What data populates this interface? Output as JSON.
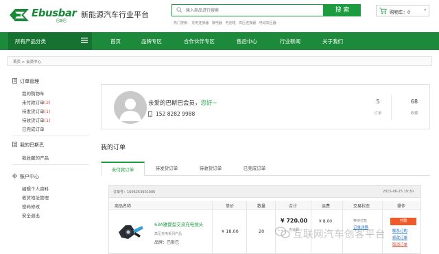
{
  "colors": {
    "brand_green": "#1d9b3f",
    "nav_green": "#1d8a3b",
    "accent_red": "#e0452b",
    "pay_orange": "#f05a28"
  },
  "header": {
    "logo_text": "Ebusbar",
    "logo_sub": "巴斯巴",
    "slogan": "新能源汽车行业平台",
    "search_placeholder": "输入商品进行搜索",
    "search_button": "搜 索",
    "hot_label": "热门搜索:",
    "hot_terms": [
      "充电连接器",
      "接电器",
      "电池箱",
      "高压连接器",
      "电动高压器"
    ],
    "cart_label": "购物车：0",
    "cart_caret": "▾"
  },
  "nav": {
    "all_label": "所有产品分类",
    "items": [
      "首页",
      "品牌专区",
      "合作伙伴专区",
      "售后中心",
      "行业新闻",
      "关于我们"
    ]
  },
  "breadcrumb": "首页 > 会员中心",
  "sidebar": {
    "groups": [
      {
        "title": "订单管理",
        "icon": "document-icon",
        "links": [
          {
            "label": "我的购物车",
            "count": ""
          },
          {
            "label": "未付款订单",
            "count": "(2)"
          },
          {
            "label": "待发货订单",
            "count": "(1)"
          },
          {
            "label": "待收货订单",
            "count": "(1)"
          },
          {
            "label": "已完成订单",
            "count": ""
          }
        ]
      },
      {
        "title": "我的巴斯巴",
        "icon": "document-icon",
        "links": [
          {
            "label": "我收藏的产品",
            "count": ""
          }
        ]
      },
      {
        "title": "账户中心",
        "icon": "gear-icon",
        "links": [
          {
            "label": "编辑个人资料",
            "count": ""
          },
          {
            "label": "收货地址管理",
            "count": ""
          },
          {
            "label": "密码修改",
            "count": ""
          },
          {
            "label": "安全退出",
            "count": ""
          }
        ]
      }
    ]
  },
  "user": {
    "greeting_prefix": "亲爱的巴斯巴会员，",
    "greeting_hi": "您好~",
    "phone": "152 8282 9988",
    "stats": [
      {
        "num": "5",
        "label": "订单"
      },
      {
        "num": "68",
        "label": "收藏"
      }
    ]
  },
  "orders": {
    "title": "我的订单",
    "tabs": [
      "未付款订单",
      "待发货订单",
      "待收货订单",
      "已完成订单"
    ],
    "order_no": "订单号：1606253901906",
    "order_date": "2015-06-25 19:30",
    "columns": [
      "商品名称",
      "单价",
      "数量",
      "合计",
      "运费",
      "交易状态",
      "操作"
    ],
    "item": {
      "name": "63A雅都型交流充电插头",
      "sub": "高压充电系列产品",
      "brand": "品牌：巴斯巴",
      "price": "¥ 18.00",
      "qty": "20",
      "total": "¥ 720.00",
      "total_note": "含运费",
      "shipping": "¥ 8.00",
      "status": "等待付款",
      "status_link": "订单详情",
      "actions": {
        "pay": "付款",
        "link1": "联系订购",
        "link2": "修改订单",
        "link3": "取消订单"
      }
    }
  },
  "watermark": "互联网汽车创客平台"
}
